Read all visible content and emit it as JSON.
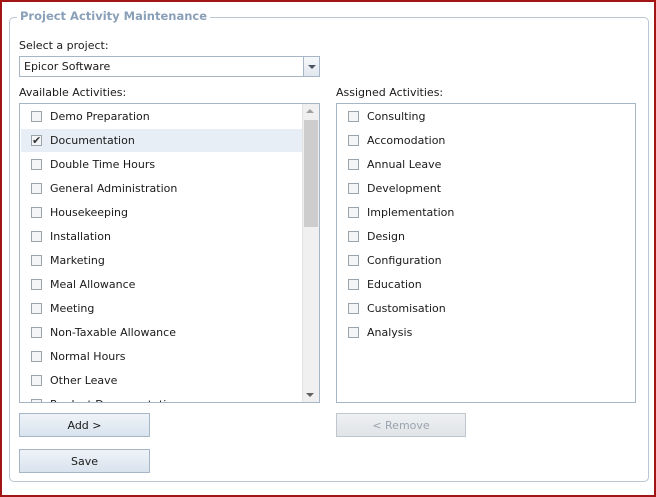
{
  "panel": {
    "title": "Project Activity Maintenance"
  },
  "project": {
    "label": "Select a project:",
    "selected": "Epicor Software"
  },
  "available": {
    "label": "Available Activities:",
    "items": [
      {
        "label": "Demo Preparation",
        "checked": false
      },
      {
        "label": "Documentation",
        "checked": true
      },
      {
        "label": "Double Time Hours",
        "checked": false
      },
      {
        "label": "General Administration",
        "checked": false
      },
      {
        "label": "Housekeeping",
        "checked": false
      },
      {
        "label": "Installation",
        "checked": false
      },
      {
        "label": "Marketing",
        "checked": false
      },
      {
        "label": "Meal Allowance",
        "checked": false
      },
      {
        "label": "Meeting",
        "checked": false
      },
      {
        "label": "Non-Taxable Allowance",
        "checked": false
      },
      {
        "label": "Normal Hours",
        "checked": false
      },
      {
        "label": "Other Leave",
        "checked": false
      },
      {
        "label": "Product Documentation",
        "checked": false
      }
    ]
  },
  "assigned": {
    "label": "Assigned Activities:",
    "items": [
      {
        "label": "Consulting",
        "checked": false
      },
      {
        "label": "Accomodation",
        "checked": false
      },
      {
        "label": "Annual Leave",
        "checked": false
      },
      {
        "label": "Development",
        "checked": false
      },
      {
        "label": "Implementation",
        "checked": false
      },
      {
        "label": "Design",
        "checked": false
      },
      {
        "label": "Configuration",
        "checked": false
      },
      {
        "label": "Education",
        "checked": false
      },
      {
        "label": "Customisation",
        "checked": false
      },
      {
        "label": "Analysis",
        "checked": false
      }
    ]
  },
  "buttons": {
    "add": "Add >",
    "remove": "< Remove",
    "save": "Save"
  },
  "colors": {
    "frame_border": "#a31515",
    "legend": "#8aa0b8",
    "selected_row": "#e7eef6"
  }
}
